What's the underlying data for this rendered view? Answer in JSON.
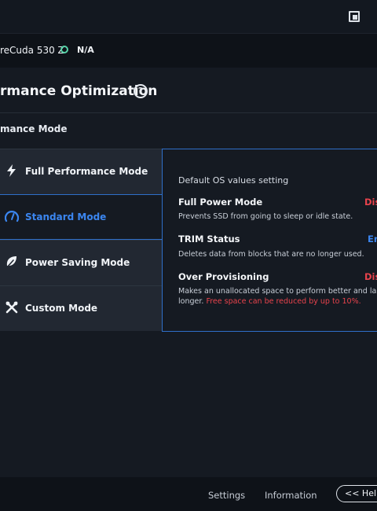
{
  "device": {
    "name": "reCuda 530 Z",
    "status": "N/A"
  },
  "section": {
    "title": "rmance Optimization",
    "help_icon": "?"
  },
  "subsection": {
    "title": "mance Mode"
  },
  "modes": [
    {
      "label": "Full Performance Mode",
      "icon": "lightning-icon",
      "active": false
    },
    {
      "label": "Standard Mode",
      "icon": "gauge-icon",
      "active": true
    },
    {
      "label": "Power Saving Mode",
      "icon": "leaf-icon",
      "active": false
    },
    {
      "label": "Custom Mode",
      "icon": "wrench-icon",
      "active": false
    }
  ],
  "details": {
    "intro": "Default OS values setting",
    "items": [
      {
        "title": "Full Power Mode",
        "status": "Dis",
        "status_color": "#e8434c",
        "description": "Prevents SSD from going to sleep or idle state."
      },
      {
        "title": "TRIM Status",
        "status": "En",
        "status_color": "#3b86f0",
        "description": "Deletes data from blocks that are no longer used."
      },
      {
        "title": "Over Provisioning",
        "status": "Dis",
        "status_color": "#e8434c",
        "description_line1": "Makes an unallocated space to perform better and las",
        "description_line2": "longer.",
        "warning": "Free space can be reduced by up to 10%."
      }
    ]
  },
  "footer": {
    "settings": "Settings",
    "information": "Information",
    "help": "<< Help"
  },
  "colors": {
    "accent": "#3b86f0",
    "warning": "#e8434c",
    "background": "#151a22"
  }
}
